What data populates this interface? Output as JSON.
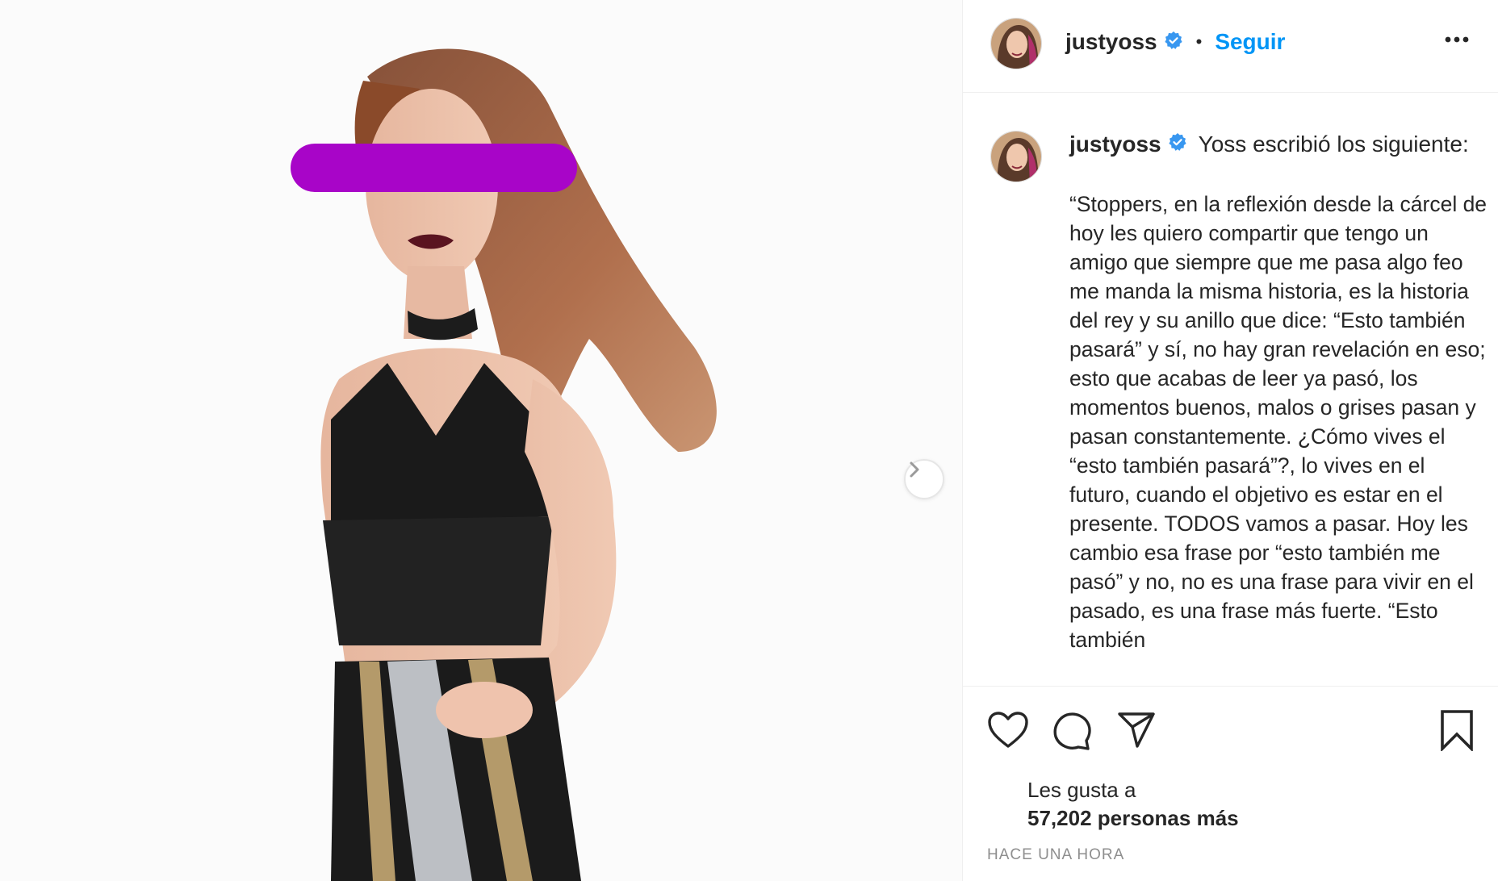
{
  "post": {
    "username": "justyoss",
    "follow_label": "Seguir",
    "separator": "•",
    "caption_lead": "Yoss escribió los siguiente:",
    "caption_body": "“Stoppers, en la reflexión desde la cárcel de hoy les quiero compartir que tengo un amigo que siempre que me pasa algo feo me manda la misma historia, es la historia del rey y su anillo que dice: “Esto también pasará” y sí, no hay gran revelación en eso; esto que acabas de leer ya pasó, los momentos buenos, malos o grises pasan y pasan constantemente. ¿Cómo vives el “esto también pasará”?, lo vives en el futuro, cuando el objetivo es estar en el presente. TODOS vamos a pasar. Hoy les cambio esa frase por “esto también me pasó” y no, no es una frase para vivir en el pasado, es una frase más fuerte. “Esto también",
    "likes_prefix": "Les gusta a",
    "likes_count": "57,202 personas más",
    "timestamp": "HACE UNA HORA"
  },
  "icons": {
    "verified": "verified-badge-icon",
    "more": "more-options-icon",
    "like": "heart-icon",
    "comment": "comment-icon",
    "share": "paper-plane-icon",
    "save": "bookmark-icon",
    "next": "chevron-right-icon"
  },
  "colors": {
    "link_blue": "#0095f6",
    "verified_blue": "#3897f0",
    "censor_bar": "#a805c8",
    "text_primary": "#262626",
    "text_secondary": "#8e8e8e",
    "border": "#efefef"
  }
}
